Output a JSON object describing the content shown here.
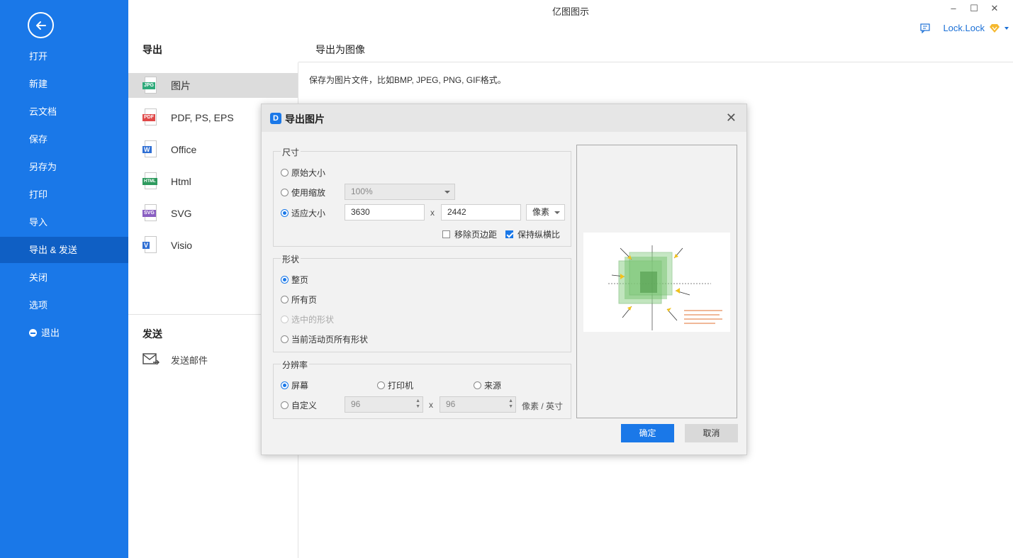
{
  "window": {
    "title": "亿图图示",
    "minimize": "–",
    "maximize": "☐",
    "close": "✕"
  },
  "user": {
    "name": "Lock.Lock"
  },
  "sidebar": {
    "items": [
      {
        "label": "打开"
      },
      {
        "label": "新建"
      },
      {
        "label": "云文档"
      },
      {
        "label": "保存"
      },
      {
        "label": "另存为"
      },
      {
        "label": "打印"
      },
      {
        "label": "导入"
      },
      {
        "label": "导出 & 发送",
        "active": true
      },
      {
        "label": "关闭"
      },
      {
        "label": "选项"
      },
      {
        "label": "退出"
      }
    ]
  },
  "export_panel": {
    "heading": "导出",
    "formats": [
      {
        "label": "图片",
        "tag": "JPG",
        "color": "#2eaa7a",
        "active": true
      },
      {
        "label": "PDF, PS, EPS",
        "tag": "PDF",
        "color": "#e04848"
      },
      {
        "label": "Office",
        "tag": "W",
        "color": "#2f6fd4"
      },
      {
        "label": "Html",
        "tag": "HTML",
        "color": "#2e9a5e"
      },
      {
        "label": "SVG",
        "tag": "SVG",
        "color": "#8a5fc2"
      },
      {
        "label": "Visio",
        "tag": "V",
        "color": "#2f6fd4"
      }
    ],
    "send_heading": "发送",
    "send_email": "发送邮件"
  },
  "content": {
    "heading": "导出为图像",
    "description": "保存为图片文件，比如BMP, JPEG, PNG, GIF格式。"
  },
  "dialog": {
    "title": "导出图片",
    "size_group": {
      "title": "尺寸",
      "original_size": "原始大小",
      "use_zoom": "使用缩放",
      "zoom_value": "100%",
      "fit_size": "适应大小",
      "width": "3630",
      "height": "2442",
      "unit": "像素",
      "remove_margin": "移除页边距",
      "keep_ratio": "保持纵横比",
      "selected": "fit_size",
      "remove_margin_checked": false,
      "keep_ratio_checked": true
    },
    "shape_group": {
      "title": "形状",
      "options": [
        "整页",
        "所有页",
        "选中的形状",
        "当前活动页所有形状"
      ],
      "selected": "整页",
      "disabled": [
        "选中的形状"
      ]
    },
    "resolution_group": {
      "title": "分辨率",
      "screen": "屏幕",
      "printer": "打印机",
      "source": "来源",
      "custom": "自定义",
      "dpi_x": "96",
      "dpi_y": "96",
      "unit": "像素 / 英寸",
      "selected": "屏幕"
    },
    "x_sep": "x",
    "ok": "确定",
    "cancel": "取消"
  }
}
